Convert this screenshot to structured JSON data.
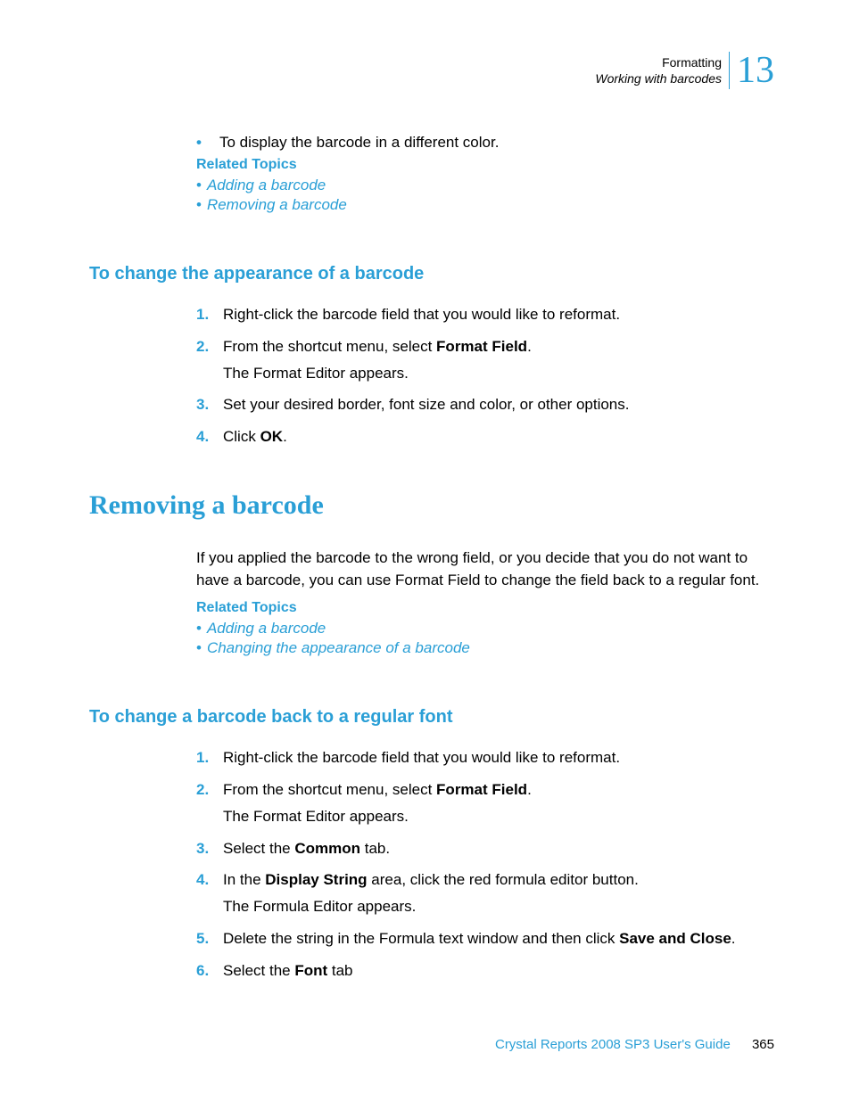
{
  "header": {
    "line1": "Formatting",
    "line2": "Working with barcodes",
    "chapter": "13"
  },
  "intro_bullet": "To display the barcode in a different color.",
  "related_topics_label": "Related Topics",
  "section1": {
    "related": [
      "Adding a barcode",
      "Removing a barcode"
    ],
    "subheading": "To change the appearance of a barcode",
    "steps": [
      {
        "num": "1.",
        "text": "Right-click the barcode field that you would like to reformat."
      },
      {
        "num": "2.",
        "text_before": "From the shortcut menu, select ",
        "bold": "Format Field",
        "text_after": ".",
        "result": "The Format Editor appears."
      },
      {
        "num": "3.",
        "text": "Set your desired border, font size and color, or other options."
      },
      {
        "num": "4.",
        "text_before": "Click ",
        "bold": "OK",
        "text_after": "."
      }
    ]
  },
  "section2": {
    "heading": "Removing a barcode",
    "para": "If you applied the barcode to the wrong field, or you decide that you do not want to have a barcode, you can use Format Field to change the field back to a regular font.",
    "related": [
      "Adding a barcode",
      "Changing the appearance of a barcode"
    ],
    "subheading": "To change a barcode back to a regular font",
    "steps": [
      {
        "num": "1.",
        "text": "Right-click the barcode field that you would like to reformat."
      },
      {
        "num": "2.",
        "text_before": "From the shortcut menu, select ",
        "bold": "Format Field",
        "text_after": ".",
        "result": "The Format Editor appears."
      },
      {
        "num": "3.",
        "text_before": "Select the ",
        "bold": "Common",
        "text_after": " tab."
      },
      {
        "num": "4.",
        "text_before": "In the ",
        "bold": "Display String",
        "text_after": " area, click the red formula editor button.",
        "result": "The Formula Editor appears."
      },
      {
        "num": "5.",
        "text_before": "Delete the string in the Formula text window and then click ",
        "bold": "Save and Close",
        "text_after": "."
      },
      {
        "num": "6.",
        "text_before": "Select the ",
        "bold": "Font",
        "text_after": " tab"
      }
    ]
  },
  "footer": {
    "title": "Crystal Reports 2008 SP3 User's Guide",
    "page": "365"
  }
}
